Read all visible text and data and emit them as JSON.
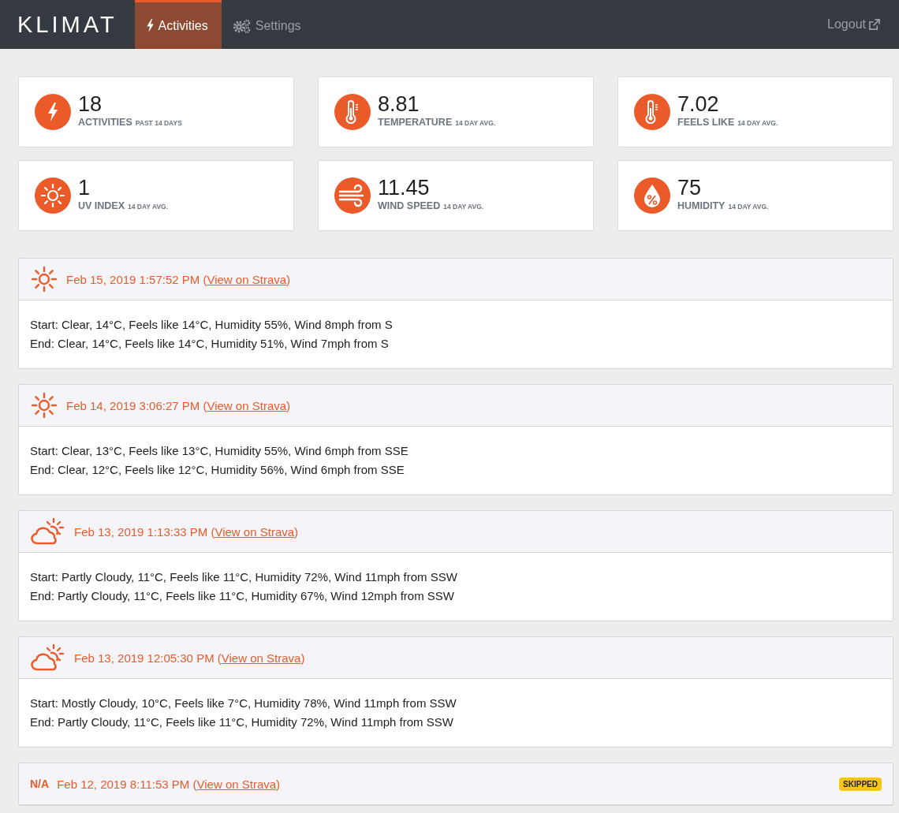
{
  "navbar": {
    "logo": "KLIMAT",
    "tabs": [
      {
        "label": "Activities",
        "kind": "bolt",
        "selected": true
      },
      {
        "label": "Settings",
        "kind": "gears",
        "selected": false
      }
    ],
    "logout": "Logout"
  },
  "stats": [
    {
      "kind": "bolt",
      "value": "18",
      "label": "ACTIVITIES",
      "sublabel": "PAST 14 DAYS"
    },
    {
      "kind": "thermometer",
      "value": "8.81",
      "label": "TEMPERATURE",
      "sublabel": "14 DAY AVG."
    },
    {
      "kind": "thermometer",
      "value": "7.02",
      "label": "FEELS LIKE",
      "sublabel": "14 DAY AVG."
    },
    {
      "kind": "sun",
      "value": "1",
      "label": "UV INDEX",
      "sublabel": "14 DAY AVG."
    },
    {
      "kind": "wind",
      "value": "11.45",
      "label": "WIND SPEED",
      "sublabel": "14 DAY AVG."
    },
    {
      "kind": "humidity",
      "value": "75",
      "label": "HUMIDITY",
      "sublabel": "14 DAY AVG."
    }
  ],
  "activities": [
    {
      "kind": "sunny",
      "heading_prefix": "Feb 15, 2019 1:57:52 PM (",
      "link": "View on Strava",
      "heading_suffix": ")",
      "lines": [
        "Start: Clear, 14°C, Feels like 14°C, Humidity 55%, Wind 8mph from S",
        "End: Clear, 14°C, Feels like 14°C, Humidity 51%, Wind 7mph from S"
      ]
    },
    {
      "kind": "sunny",
      "heading_prefix": "Feb 14, 2019 3:06:27 PM (",
      "link": "View on Strava",
      "heading_suffix": ")",
      "lines": [
        "Start: Clear, 13°C, Feels like 13°C, Humidity 55%, Wind 6mph from SSE",
        "End: Clear, 12°C, Feels like 12°C, Humidity 56%, Wind 6mph from SSE"
      ]
    },
    {
      "kind": "partly-cloudy",
      "heading_prefix": "Feb 13, 2019 1:13:33 PM (",
      "link": "View on Strava",
      "heading_suffix": ")",
      "lines": [
        "Start: Partly Cloudy, 11°C, Feels like 11°C, Humidity 72%, Wind 11mph from SSW",
        "End: Partly Cloudy, 11°C, Feels like 11°C, Humidity 67%, Wind 12mph from SSW"
      ]
    },
    {
      "kind": "partly-cloudy",
      "heading_prefix": "Feb 13, 2019 12:05:30 PM (",
      "link": "View on Strava",
      "heading_suffix": ")",
      "lines": [
        "Start: Mostly Cloudy, 10°C, Feels like 7°C, Humidity 78%, Wind 11mph from SSW",
        "End: Partly Cloudy, 11°C, Feels like 11°C, Humidity 72%, Wind 11mph from SSW"
      ]
    },
    {
      "kind": "unavailable",
      "icon_text": "N/A",
      "heading_prefix": "Feb 12, 2019 8:11:53 PM (",
      "link": "View on Strava",
      "heading_suffix": ")",
      "badge": "SKIPPED"
    }
  ]
}
